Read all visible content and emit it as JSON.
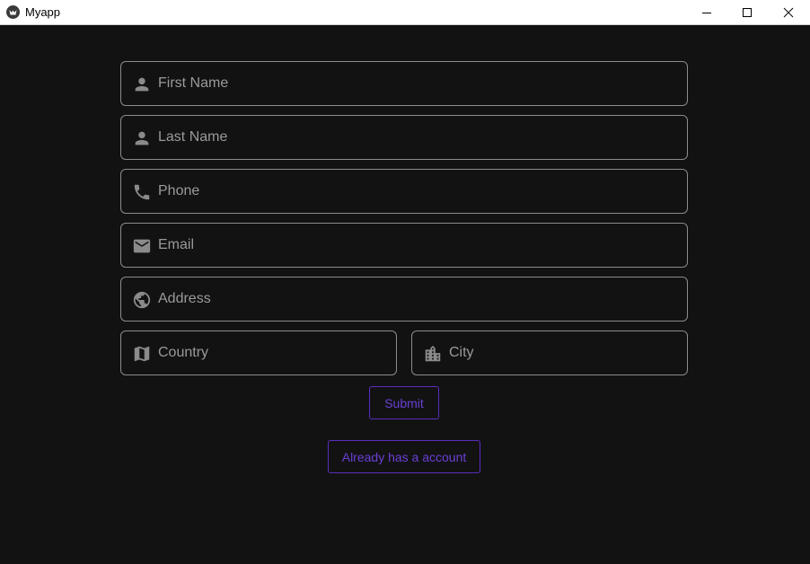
{
  "window": {
    "title": "Myapp"
  },
  "form": {
    "fields": [
      {
        "label": "First Name",
        "icon": "person-icon"
      },
      {
        "label": "Last Name",
        "icon": "person-icon"
      },
      {
        "label": "Phone",
        "icon": "phone-icon"
      },
      {
        "label": "Email",
        "icon": "mail-icon"
      },
      {
        "label": "Address",
        "icon": "globe-icon"
      },
      {
        "label": "Country",
        "icon": "map-icon"
      },
      {
        "label": "City",
        "icon": "city-icon"
      }
    ],
    "submit_label": "Submit",
    "login_label": "Already has a account"
  },
  "colors": {
    "background": "#121212",
    "field_border": "#8c8c8c",
    "label_text": "#9a9a9a",
    "accent": "#6a3fd6"
  }
}
